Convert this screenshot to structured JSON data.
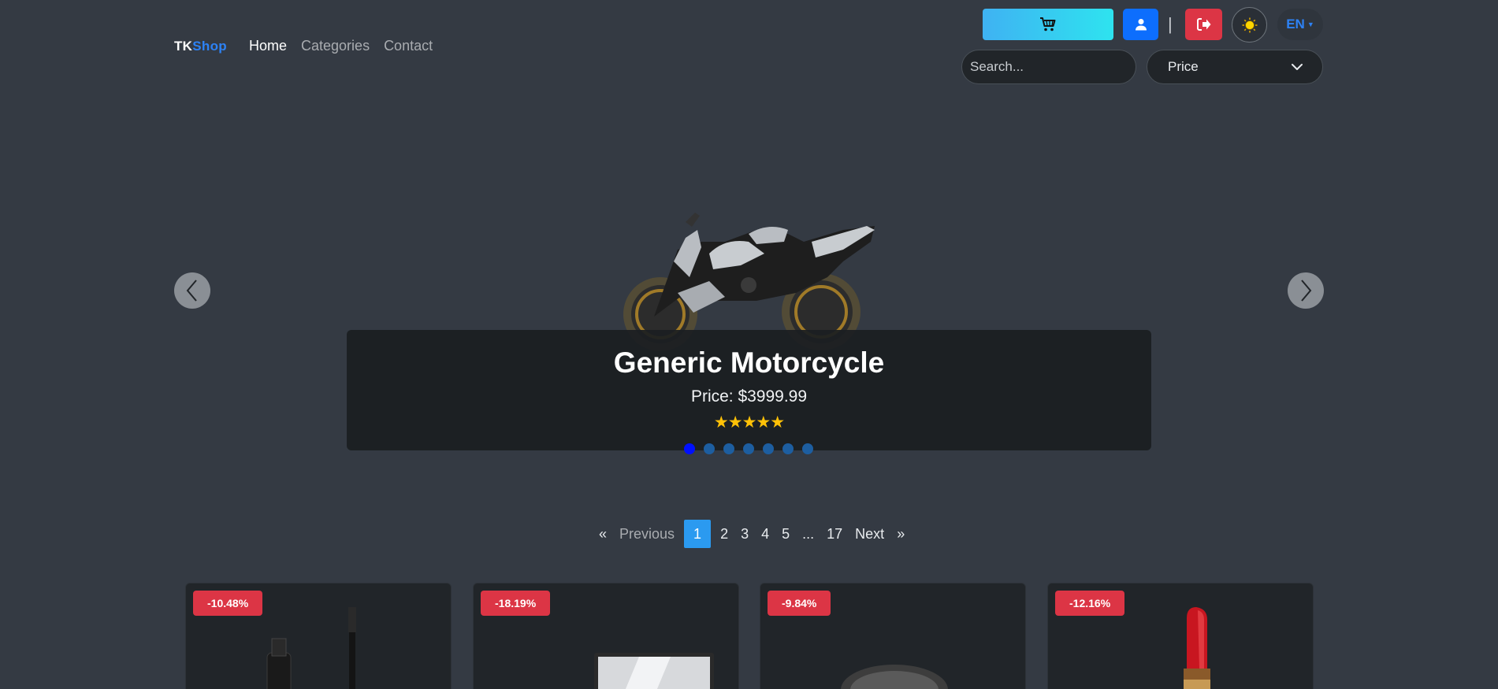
{
  "brand": {
    "part1": "TK",
    "part2": "Shop"
  },
  "nav": {
    "home": "Home",
    "categories": "Categories",
    "contact": "Contact"
  },
  "header": {
    "separator": "|",
    "lang_label": "EN",
    "search_placeholder": "Search...",
    "sort_selected": "Price"
  },
  "carousel": {
    "title": "Generic Motorcycle",
    "price": "Price: $3999.99",
    "stars": "★★★★★",
    "slide_count": 7,
    "active_slide": 1
  },
  "pagination": {
    "prev_arrow": "«",
    "prev_label": "Previous",
    "pages": [
      "1",
      "2",
      "3",
      "4",
      "5",
      "...",
      "17"
    ],
    "active_page": "1",
    "next_label": "Next",
    "next_arrow": "»"
  },
  "products": [
    {
      "discount": "-10.48%",
      "image": "mascara-icon"
    },
    {
      "discount": "-18.19%",
      "image": "mirror-icon"
    },
    {
      "discount": "-9.84%",
      "image": "powder-compact-icon"
    },
    {
      "discount": "-12.16%",
      "image": "lipstick-icon"
    }
  ],
  "colors": {
    "background": "#343a43",
    "primary": "#0d6efd",
    "danger": "#dc3545",
    "cart_gradient_start": "#3fb2f2",
    "cart_gradient_end": "#2ee3ef",
    "accent": "#2d82f5",
    "star": "#ffc107",
    "active_page": "#2b9af0"
  }
}
